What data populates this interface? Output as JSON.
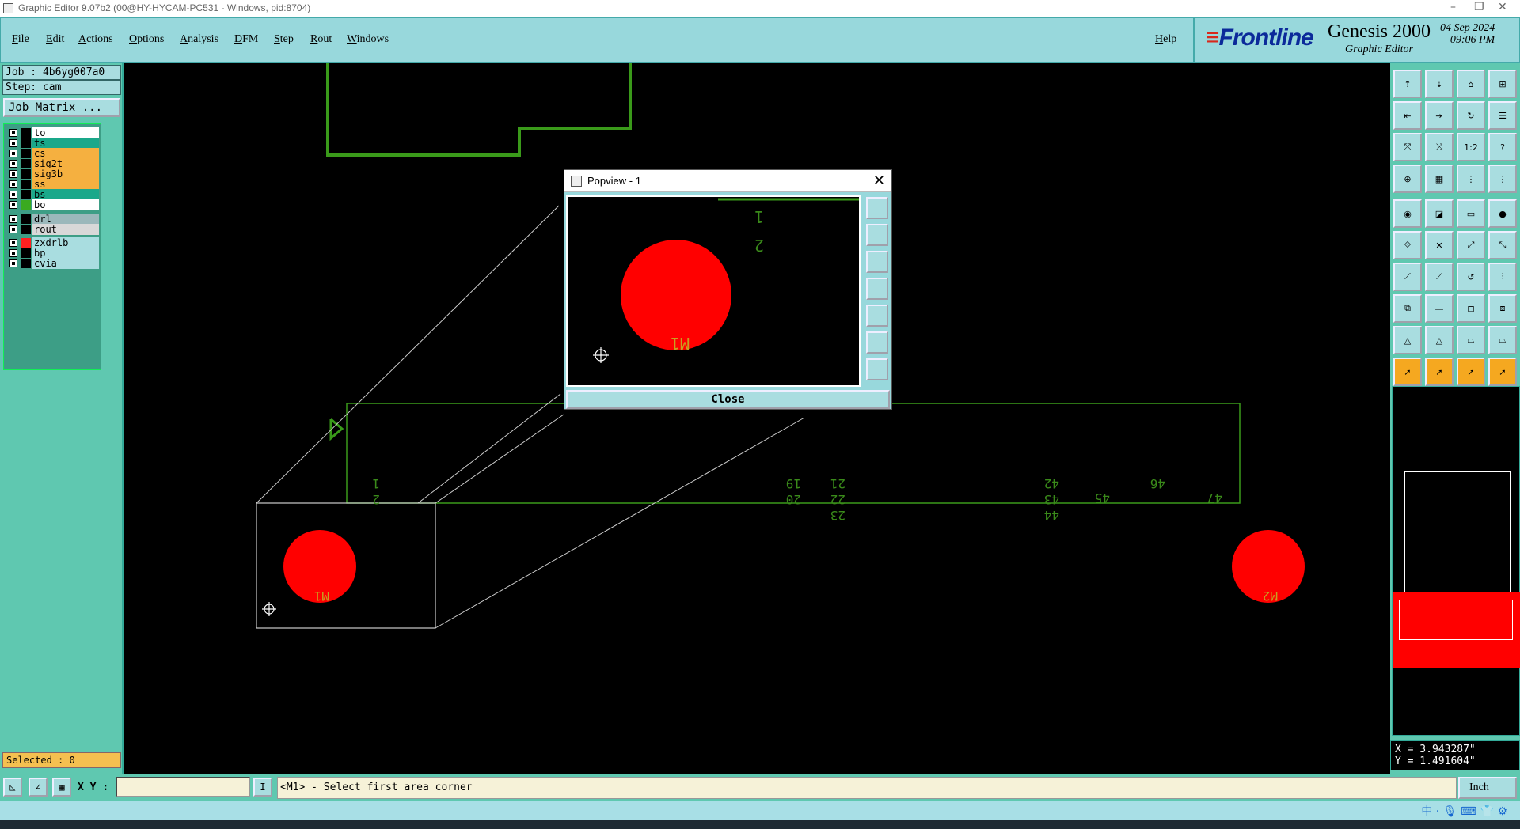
{
  "window": {
    "title": "Graphic Editor 9.07b2 (00@HY-HYCAM-PC531 - Windows, pid:8704)",
    "minimize": "–",
    "restore": "❐",
    "close": "✕"
  },
  "menu": {
    "items": [
      "File",
      "Edit",
      "Actions",
      "Options",
      "Analysis",
      "DFM",
      "Step",
      "Rout",
      "Windows"
    ],
    "help": "Help"
  },
  "logo": {
    "brand": "Frontline",
    "product": "Genesis 2000",
    "subtitle": "Graphic Editor",
    "date": "04 Sep 2024",
    "time": "09:06 PM"
  },
  "job": {
    "job_line": "Job : 4b6yg007a0",
    "step_line": "Step: cam",
    "matrix_button": "Job Matrix ..."
  },
  "layers": [
    {
      "name": "to",
      "swatch": "#000000",
      "bg": "#ffffff"
    },
    {
      "name": "ts",
      "swatch": "#000000",
      "bg": "#1aa88a"
    },
    {
      "name": "cs",
      "swatch": "#000000",
      "bg": "#f5b040"
    },
    {
      "name": "sig2t",
      "swatch": "#000000",
      "bg": "#f5b040"
    },
    {
      "name": "sig3b",
      "swatch": "#000000",
      "bg": "#f5b040"
    },
    {
      "name": "ss",
      "swatch": "#000000",
      "bg": "#f5b040"
    },
    {
      "name": "bs",
      "swatch": "#000000",
      "bg": "#1aa88a"
    },
    {
      "name": "bo",
      "swatch": "#3aaa20",
      "bg": "#ffffff"
    },
    {
      "name": "drl",
      "swatch": "#000000",
      "bg": "#9bb8bb"
    },
    {
      "name": "rout",
      "swatch": "#000000",
      "bg": "#d8d8d8"
    },
    {
      "name": "zxdrlb",
      "swatch": "#ff2020",
      "bg": "#a9dde0"
    },
    {
      "name": "bp",
      "swatch": "#000000",
      "bg": "#a9dde0"
    },
    {
      "name": "cvia",
      "swatch": "#000000",
      "bg": "#a9dde0"
    }
  ],
  "selected": "Selected : 0",
  "coords": {
    "x": "X = 3.943287\"",
    "y": "Y = 1.491604\""
  },
  "bottom": {
    "xy_label": "X Y :",
    "xy_value": "",
    "message": "<M1> - Select first area corner",
    "unit": "Inch"
  },
  "popview": {
    "title": "Popview - 1",
    "close_label": "Close"
  },
  "canvas_labels": {
    "main_pads": [
      "M1",
      "M2"
    ],
    "numbers": [
      "1",
      "2",
      "19",
      "20",
      "21",
      "22",
      "23",
      "42",
      "43",
      "44",
      "45",
      "46",
      "47"
    ],
    "popview_numbers": [
      "1",
      "2"
    ],
    "popview_pad": "M1"
  },
  "ime": {
    "text": "中 ·  🎙 ⌨ 👕 ⚙"
  }
}
